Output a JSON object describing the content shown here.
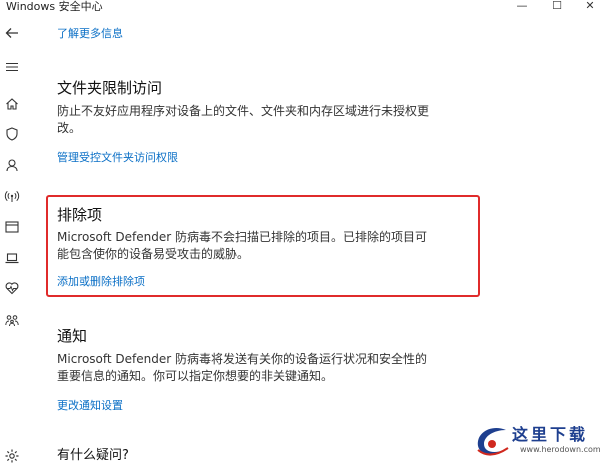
{
  "window": {
    "title": "Windows 安全中心",
    "minimize_glyph": "—",
    "maximize_glyph": "☐",
    "close_glyph": "✕"
  },
  "sidebar": {
    "icons": [
      "back-arrow-icon",
      "menu-icon",
      "home-icon",
      "shield-icon",
      "account-icon",
      "wifi-antenna-icon",
      "app-browser-icon",
      "laptop-icon",
      "heart-icon",
      "family-icon",
      "gear-icon"
    ]
  },
  "main": {
    "top_link": "了解更多信息",
    "folder_section": {
      "title": "文件夹限制访问",
      "description": "防止不友好应用程序对设备上的文件、文件夹和内存区域进行未授权更改。",
      "link": "管理受控文件夹访问权限"
    },
    "exclusions_section": {
      "title": "排除项",
      "description": "Microsoft Defender 防病毒不会扫描已排除的项目。已排除的项目可能包含使你的设备易受攻击的威胁。",
      "link": "添加或删除排除项"
    },
    "notifications_section": {
      "title": "通知",
      "description": "Microsoft Defender 防病毒将发送有关你的设备运行状况和安全性的重要信息的通知。你可以指定你想要的非关键通知。",
      "link": "更改通知设置"
    },
    "questions_heading": "有什么疑问?"
  },
  "watermark": {
    "text": "这里下载",
    "url": "www.herodown.com"
  },
  "colors": {
    "link": "#0a6fc6",
    "highlight_border": "#e02b2b",
    "watermark_blue": "#1e3f8f",
    "watermark_red": "#d0281e"
  }
}
